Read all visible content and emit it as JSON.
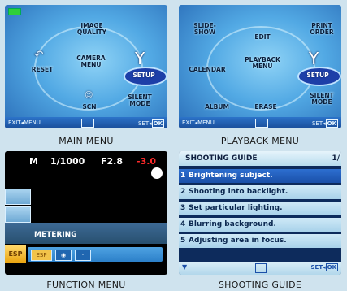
{
  "captions": {
    "main": "MAIN MENU",
    "playback": "PLAYBACK MENU",
    "function": "FUNCTION MENU",
    "guide": "SHOOTING GUIDE"
  },
  "main_menu": {
    "items": [
      "IMAGE\nQUALITY",
      "RESET",
      "CAMERA\nMENU",
      "SETUP",
      "SCN",
      "SILENT\nMODE"
    ],
    "selected": "SETUP",
    "exit": "EXIT",
    "set": "SET",
    "ok": "OK"
  },
  "playback_menu": {
    "items": [
      "SLIDE-\nSHOW",
      "EDIT",
      "PRINT\nORDER",
      "CALENDAR",
      "PLAYBACK\nMENU",
      "SETUP",
      "ALBUM",
      "ERASE",
      "SILENT\nMODE"
    ],
    "selected": "SETUP",
    "exit": "EXIT",
    "set": "SET",
    "ok": "OK"
  },
  "function_menu": {
    "mode": "M",
    "shutter": "1/1000",
    "aperture": "F2.8",
    "exposure": "-3.0",
    "label": "METERING",
    "selected_option": "ESP",
    "strip_selected": "ESP"
  },
  "shooting_guide": {
    "title": "SHOOTING GUIDE",
    "page": "1/",
    "items": [
      {
        "num": "1",
        "text": "Brightening subject."
      },
      {
        "num": "2",
        "text": "Shooting into backlight."
      },
      {
        "num": "3",
        "text": "Set particular lighting."
      },
      {
        "num": "4",
        "text": "Blurring background."
      },
      {
        "num": "5",
        "text": "Adjusting area in focus."
      }
    ],
    "selected_index": 0,
    "set": "SET",
    "ok": "OK"
  },
  "colors": {
    "menu_blue": "#52a9e4",
    "selected_blue": "#1d3fa8",
    "exposure_red": "#ff2a2a",
    "esp_orange": "#e9a20d"
  }
}
